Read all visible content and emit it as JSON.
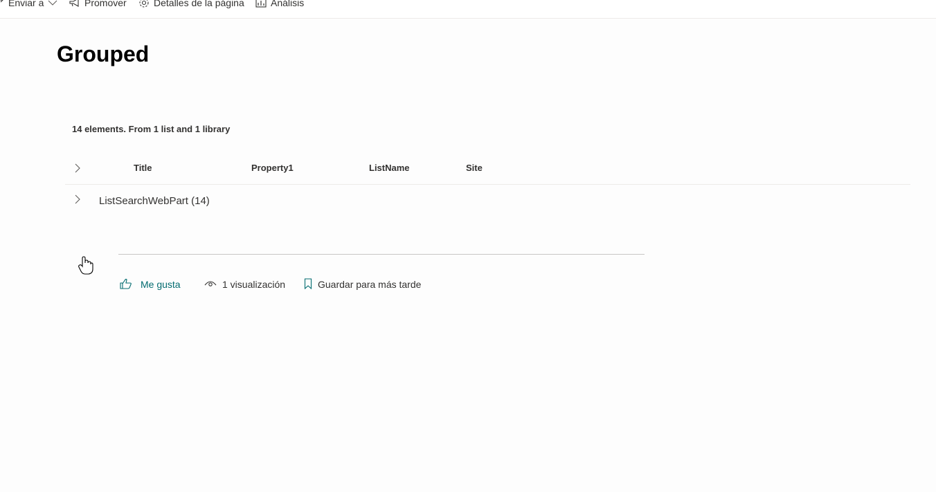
{
  "command_bar": {
    "send_to": "Enviar a",
    "promote": "Promover",
    "page_details": "Detalles de la página",
    "analytics": "Análisis"
  },
  "page": {
    "title": "Grouped"
  },
  "webpart": {
    "summary": "14 elements. From 1 list and 1 library",
    "columns": [
      "Title",
      "Property1",
      "ListName",
      "Site"
    ],
    "group_label": "ListSearchWebPart (14)"
  },
  "social": {
    "like": "Me gusta",
    "views": "1 visualización",
    "save": "Guardar para más tarde"
  },
  "colors": {
    "accent": "#036c70",
    "text": "#323130",
    "divider": "#c8c6c4"
  },
  "icons": {
    "send_to": "share-icon",
    "send_to_caret": "chevron-down-icon",
    "promote": "megaphone-icon",
    "page_details": "gear-icon",
    "analytics": "chart-icon",
    "expand_all": "chevron-right-icon",
    "expand_group": "chevron-right-icon",
    "like": "thumbs-up-icon",
    "views": "eye-icon",
    "save": "bookmark-icon",
    "cursor": "hand-pointer-icon"
  }
}
